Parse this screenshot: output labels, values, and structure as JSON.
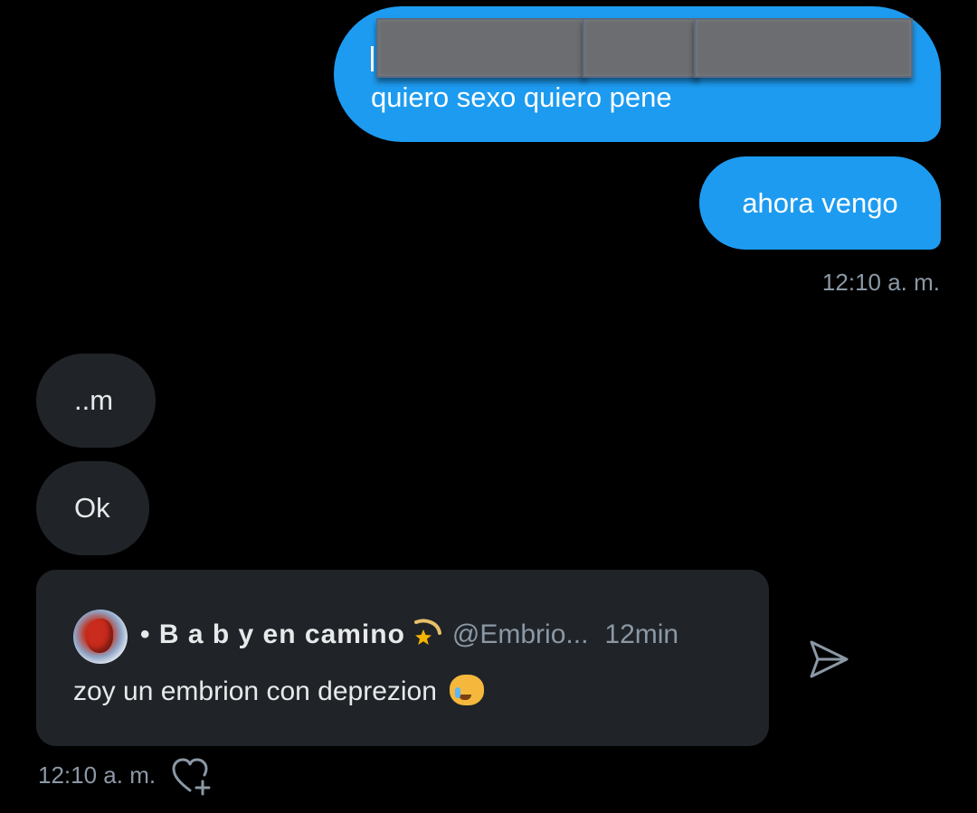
{
  "messages": {
    "outgoing": [
      {
        "redacted_line": "",
        "text": "quiero sexo quiero pene"
      },
      {
        "text": "ahora vengo"
      }
    ],
    "outgoing_timestamp": "12:10 a. m.",
    "incoming": [
      {
        "text": "..m"
      },
      {
        "text": "Ok"
      }
    ],
    "incoming_timestamp": "12:10 a. m."
  },
  "shared_tweet": {
    "avatar": "embryo-avatar",
    "display_name": "• B a b y  en camino",
    "name_emoji": "shooting-star",
    "handle": "@Embrio...",
    "time": "12min",
    "text": "zoy un embrion con deprezion",
    "text_emoji": "crying-cat-face"
  },
  "icons": {
    "share": "send-icon",
    "reaction": "heart-add-icon"
  },
  "colors": {
    "background": "#000000",
    "outgoing_bubble": "#1d9bf0",
    "incoming_bubble": "#202428",
    "text_primary": "#e7e9ea",
    "text_secondary": "#8b98a5"
  }
}
